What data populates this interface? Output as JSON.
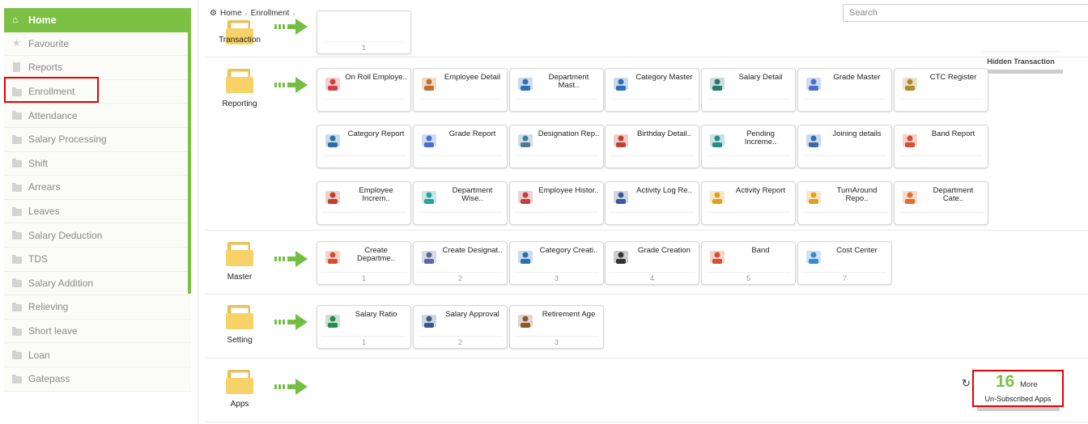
{
  "sidebar": {
    "items": [
      {
        "label": "Home",
        "icon": "home-icon",
        "active": true
      },
      {
        "label": "Favourite",
        "icon": "star-icon"
      },
      {
        "label": "Reports",
        "icon": "document-icon"
      },
      {
        "label": "Enrollment",
        "icon": "folder-icon"
      },
      {
        "label": "Attendance",
        "icon": "folder-icon"
      },
      {
        "label": "Salary Processing",
        "icon": "folder-icon"
      },
      {
        "label": "Shift",
        "icon": "folder-icon"
      },
      {
        "label": "Arrears",
        "icon": "folder-icon"
      },
      {
        "label": "Leaves",
        "icon": "folder-icon"
      },
      {
        "label": "Salary Deduction",
        "icon": "folder-icon"
      },
      {
        "label": "TDS",
        "icon": "folder-icon"
      },
      {
        "label": "Salary Addition",
        "icon": "folder-icon"
      },
      {
        "label": "Relieving",
        "icon": "folder-icon"
      },
      {
        "label": "Short leave",
        "icon": "folder-icon"
      },
      {
        "label": "Loan",
        "icon": "folder-icon"
      },
      {
        "label": "Gatepass",
        "icon": "folder-icon"
      }
    ]
  },
  "breadcrumb": {
    "home": "Home",
    "current": "Enrollment"
  },
  "search": {
    "placeholder": "Search"
  },
  "sections": {
    "transaction": {
      "label": "Transaction",
      "hidden_label": "Hidden Transaction",
      "tiles": [
        {
          "num": "1"
        }
      ]
    },
    "reporting": {
      "label": "Reporting",
      "tiles": [
        {
          "label": "On Roll Employe..",
          "icon": "employee-icon",
          "color": "#d04040"
        },
        {
          "label": "Employee Detail",
          "icon": "employee-detail-icon",
          "color": "#c0702a"
        },
        {
          "label": "Department Mast..",
          "icon": "department-icon",
          "color": "#2d6fb5"
        },
        {
          "label": "Category Master",
          "icon": "category-icon",
          "color": "#2d6fb5"
        },
        {
          "label": "Salary Detail",
          "icon": "salary-icon",
          "color": "#2a7a6a"
        },
        {
          "label": "Grade Master",
          "icon": "grade-icon",
          "color": "#4a6fd0"
        },
        {
          "label": "CTC Register",
          "icon": "ctc-icon",
          "color": "#b08a2a"
        },
        {
          "label": "Category Report",
          "icon": "category-report-icon",
          "color": "#2a6fa5"
        },
        {
          "label": "Grade Report",
          "icon": "grade-report-icon",
          "color": "#4a6fd0"
        },
        {
          "label": "Designation Rep..",
          "icon": "designation-icon",
          "color": "#4a7a9a"
        },
        {
          "label": "Birthday Detail..",
          "icon": "birthday-icon",
          "color": "#c04030"
        },
        {
          "label": "Pending Increme..",
          "icon": "increment-icon",
          "color": "#2a8a8a"
        },
        {
          "label": "Joining details",
          "icon": "joining-icon",
          "color": "#3a6aaa"
        },
        {
          "label": "Band Report",
          "icon": "band-icon",
          "color": "#d05030"
        },
        {
          "label": "Employee Increm..",
          "icon": "employee-increment-icon",
          "color": "#c0402a"
        },
        {
          "label": "Department Wise..",
          "icon": "department-wise-icon",
          "color": "#2aa0a0"
        },
        {
          "label": "Employee Histor..",
          "icon": "history-icon",
          "color": "#c04040"
        },
        {
          "label": "Activity Log Re..",
          "icon": "activity-log-icon",
          "color": "#3a5a9a"
        },
        {
          "label": "Activity Report",
          "icon": "activity-report-icon",
          "color": "#e0a020"
        },
        {
          "label": "TurnAround Repo..",
          "icon": "turnaround-icon",
          "color": "#e0a020"
        },
        {
          "label": "Department Cate..",
          "icon": "department-category-icon",
          "color": "#e07030"
        }
      ]
    },
    "master": {
      "label": "Master",
      "tiles": [
        {
          "label": "Create Departme..",
          "num": "1",
          "icon": "create-department-icon",
          "color": "#d05030"
        },
        {
          "label": "Create Designat..",
          "num": "2",
          "icon": "create-designation-icon",
          "color": "#5a6aa0"
        },
        {
          "label": "Category Creati..",
          "num": "3",
          "icon": "category-creation-icon",
          "color": "#2d6fb5"
        },
        {
          "label": "Grade Creation",
          "num": "4",
          "icon": "grade-creation-icon",
          "color": "#333333"
        },
        {
          "label": "Band",
          "num": "5",
          "icon": "band-icon",
          "color": "#d05030"
        },
        {
          "label": "Cost Center",
          "num": "7",
          "icon": "cost-center-icon",
          "color": "#3a8ad0"
        }
      ]
    },
    "setting": {
      "label": "Setting",
      "tiles": [
        {
          "label": "Salary Ratio",
          "num": "1",
          "icon": "salary-ratio-icon",
          "color": "#2a8a4a"
        },
        {
          "label": "Salary Approval",
          "num": "2",
          "icon": "salary-approval-icon",
          "color": "#3a5a8a"
        },
        {
          "label": "Retirement Age",
          "num": "3",
          "icon": "retirement-icon",
          "color": "#8a5a2a"
        }
      ]
    },
    "apps": {
      "label": "Apps",
      "more_count": "16",
      "more_label": "More",
      "unsubscribed_label": "Un-Subscribed Apps"
    }
  }
}
